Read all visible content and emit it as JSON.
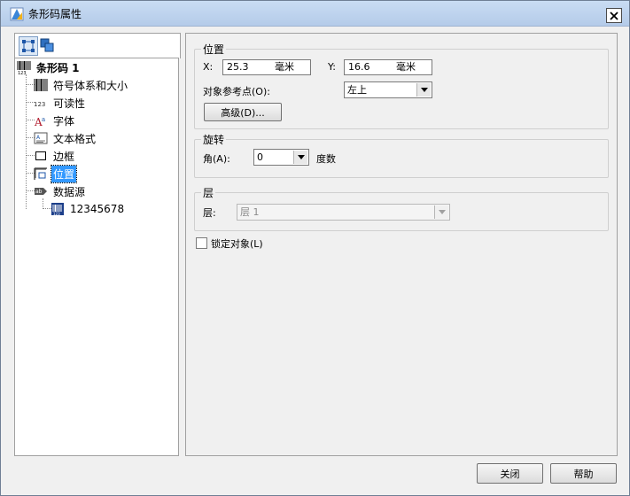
{
  "window": {
    "title": "条形码属性"
  },
  "tree": {
    "root": "条形码 1",
    "items": [
      {
        "label": "符号体系和大小",
        "icon": "barcode-icon"
      },
      {
        "label": "可读性",
        "icon": "readable-123-icon"
      },
      {
        "label": "字体",
        "icon": "font-icon"
      },
      {
        "label": "文本格式",
        "icon": "text-format-icon"
      },
      {
        "label": "边框",
        "icon": "border-icon"
      },
      {
        "label": "位置",
        "icon": "position-icon",
        "selected": true
      },
      {
        "label": "数据源",
        "icon": "data-source-icon"
      }
    ],
    "child": {
      "label": "12345678",
      "icon": "data-item-icon"
    }
  },
  "position_group": {
    "label": "位置",
    "x_label": "X:",
    "x_value": "25.3",
    "x_unit": "毫米",
    "y_label": "Y:",
    "y_value": "16.6",
    "y_unit": "毫米",
    "anchor_label": "对象参考点(O):",
    "anchor_value": "左上",
    "advanced_button": "高级(D)..."
  },
  "rotation_group": {
    "label": "旋转",
    "angle_label": "角(A):",
    "angle_value": "0",
    "angle_unit": "度数"
  },
  "layer_group": {
    "label": "层",
    "layer_label": "层:",
    "layer_value": "层 1"
  },
  "lock_checkbox": {
    "label": "锁定对象(L)",
    "checked": false
  },
  "footer": {
    "close_button": "关闭",
    "help_button": "帮助"
  }
}
